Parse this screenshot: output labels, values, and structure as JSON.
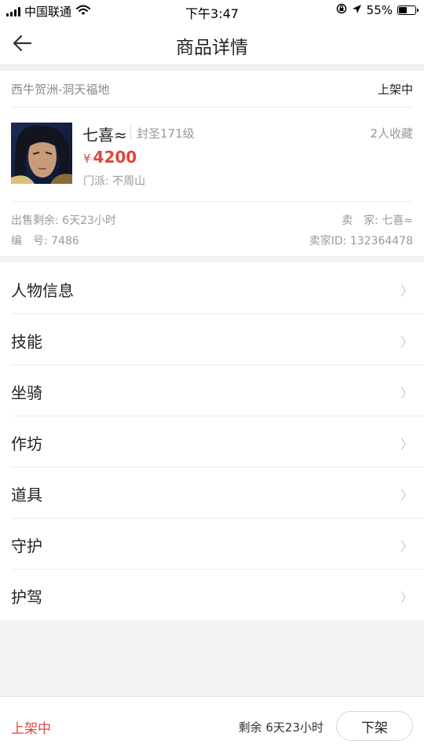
{
  "status_bar": {
    "carrier": "中国联通",
    "time": "下午3:47",
    "battery_text": "55%",
    "battery_level": 0.55
  },
  "nav": {
    "title": "商品详情",
    "back_icon": "arrow-left-icon"
  },
  "product": {
    "server": "西牛贺洲-洞天福地",
    "listing_status": "上架中",
    "character_name": "七喜≈",
    "level": "封圣171级",
    "favorites": "2人收藏",
    "currency_symbol": "¥",
    "price": "4200",
    "school": "门派: 不周山",
    "sale_remaining": "出售剩余: 6天23小时",
    "seller": "卖　家: 七喜≈",
    "serial_number": "编　号: 7486",
    "seller_id": "卖家ID: 132364478"
  },
  "menu": {
    "items": [
      {
        "label": "人物信息"
      },
      {
        "label": "技能"
      },
      {
        "label": "坐骑"
      },
      {
        "label": "作坊"
      },
      {
        "label": "道具"
      },
      {
        "label": "守护"
      },
      {
        "label": "护驾"
      }
    ],
    "chevron": "〉"
  },
  "bottom_bar": {
    "status": "上架中",
    "remaining": "剩余 6天23小时",
    "delist_label": "下架"
  },
  "colors": {
    "accent_red": "#e0463a",
    "text_primary": "#222222",
    "text_secondary": "#999999",
    "background": "#f2f2f2"
  }
}
